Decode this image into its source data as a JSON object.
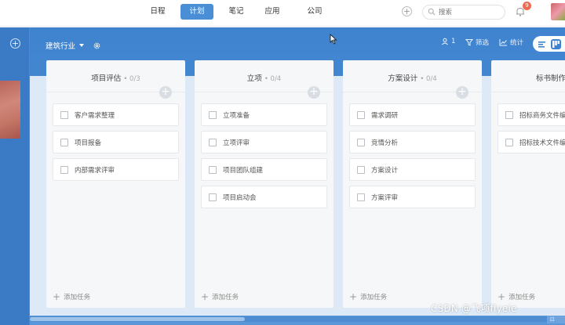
{
  "topnav": {
    "tabs": [
      {
        "label": "日程",
        "active": false
      },
      {
        "label": "计划",
        "active": true
      },
      {
        "label": "笔记",
        "active": false
      },
      {
        "label": "应用",
        "active": false
      },
      {
        "label": "公司",
        "active": false
      }
    ],
    "search_placeholder": "搜索",
    "notification_count": "9",
    "icons": [
      "plus-circle-icon",
      "search-icon",
      "bell-icon",
      "avatar"
    ]
  },
  "header": {
    "project_name": "建筑行业",
    "member_count": "1",
    "filter_label": "筛选",
    "stats_label": "统计"
  },
  "columns": [
    {
      "title": "项目评估",
      "count": "0/3",
      "tasks": [
        "客户需求整理",
        "项目报备",
        "内部需求评审"
      ]
    },
    {
      "title": "立项",
      "count": "0/4",
      "tasks": [
        "立项准备",
        "立项评审",
        "项目团队组建",
        "项目启动会"
      ]
    },
    {
      "title": "方案设计",
      "count": "0/4",
      "tasks": [
        "需求调研",
        "竞情分析",
        "方案设计",
        "方案评审"
      ]
    },
    {
      "title": "标书制作",
      "count": "",
      "tasks": [
        "招标商务文件编",
        "招标技术文件编"
      ]
    }
  ],
  "add_task_label": "添加任务",
  "watermark": "CSDN @飞项flyele",
  "colors": {
    "accent": "#4a8fd6",
    "workspace": "#3f83cf",
    "badge": "#f06a4f"
  }
}
